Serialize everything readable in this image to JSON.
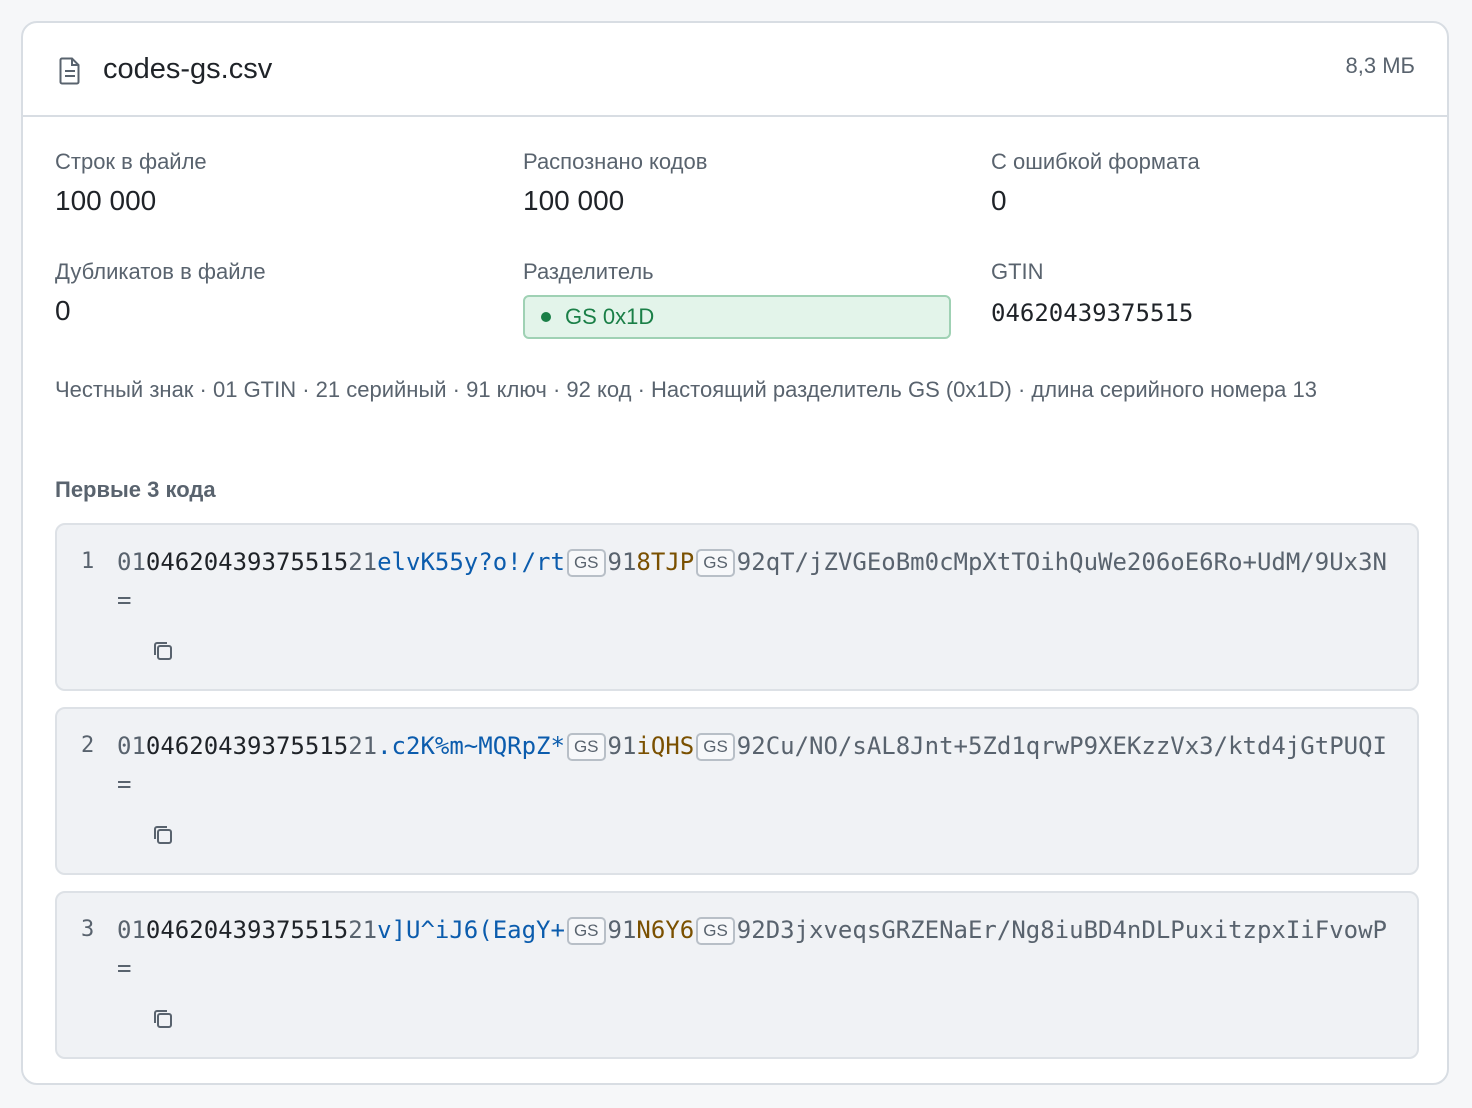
{
  "file": {
    "name": "codes-gs.csv",
    "size": "8,3 МБ",
    "icon": "file-icon"
  },
  "stats": {
    "rows": {
      "label": "Строк в файле",
      "value": "100 000"
    },
    "recognized": {
      "label": "Распознано кодов",
      "value": "100 000"
    },
    "format_errors": {
      "label": "С ошибкой формата",
      "value": "0"
    },
    "duplicates": {
      "label": "Дубликатов в файле",
      "value": "0"
    },
    "separator": {
      "label": "Разделитель",
      "value": "GS 0x1D"
    },
    "gtin": {
      "label": "GTIN",
      "value": "04620439375515"
    }
  },
  "description": "Честный знак · 01 GTIN · 21 серийный · 91 ключ · 92 код · Настоящий разделитель GS (0x1D) · длина серийного номера 13",
  "codes_section": {
    "title": "Первые 3 кода",
    "gs_label": "GS",
    "codes": [
      {
        "num": "1",
        "ai01": "01",
        "gtin": "04620439375515",
        "ai21": "21",
        "serial": "elvK55y?o!/rt",
        "ai91": "91",
        "key": "8TJP",
        "ai92": "92",
        "code": "qT/jZVGEoBm0cMpXtTOihQuWe206oE6Ro+UdM/9Ux3N="
      },
      {
        "num": "2",
        "ai01": "01",
        "gtin": "04620439375515",
        "ai21": "21",
        "serial": ".c2K%m~MQRpZ*",
        "ai91": "91",
        "key": "iQHS",
        "ai92": "92",
        "code": "Cu/NO/sAL8Jnt+5Zd1qrwP9XEKzzVx3/ktd4jGtPUQI="
      },
      {
        "num": "3",
        "ai01": "01",
        "gtin": "04620439375515",
        "ai21": "21",
        "serial": "v]U^iJ6(EagY+",
        "ai91": "91",
        "key": "N6Y6",
        "ai92": "92",
        "code": "D3jxveqsGRZENaEr/Ng8iuBD4nDLPuxitzpxIiFvowP="
      }
    ]
  },
  "colors": {
    "accent_green": "#1a7f47",
    "serial_blue": "#0b5cad",
    "key_brown": "#7a5000"
  }
}
